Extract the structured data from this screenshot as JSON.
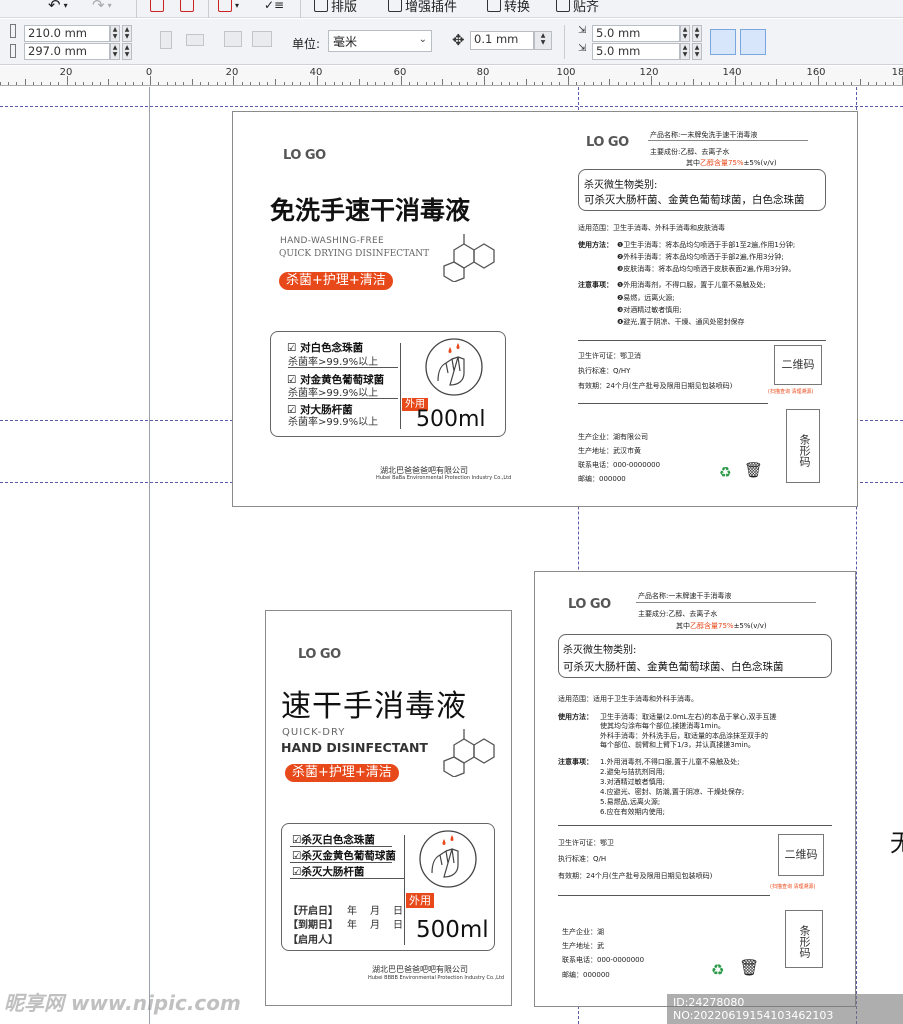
{
  "toolbar_top": {
    "items": [
      {
        "label": "排版"
      },
      {
        "label": "增强插件"
      },
      {
        "label": "转换"
      },
      {
        "label": "贴齐"
      }
    ]
  },
  "property_bar": {
    "width": "210.0 mm",
    "height": "297.0 mm",
    "unit_label": "单位:",
    "unit_value": "毫米",
    "nudge": "0.1 mm",
    "dup_x": "5.0 mm",
    "dup_y": "5.0 mm"
  },
  "ruler": {
    "labels": [
      "20",
      "0",
      "20",
      "40",
      "60",
      "80",
      "100",
      "120",
      "140",
      "160",
      "18"
    ]
  },
  "label1": {
    "logo": "LO GO",
    "title": "免洗手速干消毒液",
    "en1": "HAND-WASHING-FREE",
    "en2": "QUICK DRYING DISINFECTANT",
    "pill": "杀菌+护理+清洁",
    "claims": [
      {
        "title": "对白色念珠菌",
        "rate": "杀菌率>99.9%以上"
      },
      {
        "title": "对金黄色葡萄球菌",
        "rate": "杀菌率>99.9%以上"
      },
      {
        "title": "对大肠杆菌",
        "rate": "杀菌率>99.9%以上"
      }
    ],
    "tag": "外用",
    "volume": "500ml",
    "company": "湖北巴爸爸爸吧有限公司",
    "company_en": "Hubei BaBa Environmental Protection Industry Co.,Ltd"
  },
  "label1_back": {
    "logo": "LO GO",
    "name": "产品名称:一末牌免洗手速干消毒液",
    "ingredients": "主要成份:乙醇、去离子水",
    "content_prefix": "其中",
    "content_red": "乙醇含量75%",
    "content_suffix": "±5%(v/v)",
    "kill_head": "杀灭微生物类别:",
    "kill_list": "可杀灭大肠杆菌、金黄色葡萄球菌，白色念珠菌",
    "scope": "适用范围：卫生手消毒、外科手消毒和皮肤消毒",
    "usage_head": "使用方法：",
    "usage": [
      "❶卫生手消毒：将本品均匀喷洒于手部1至2遍,作用1分钟;",
      "❷外科手消毒：将本品均匀喷洒于手部2遍,作用3分钟;",
      "❸皮肤消毒：将本品均匀喷洒于皮肤表面2遍,作用3分钟。"
    ],
    "notes_head": "注意事项：",
    "notes": [
      "❶外用消毒剂，不得口服，置于儿童不易触及处;",
      "❷易燃，远离火源;",
      "❸对酒精过敏者慎用;",
      "❹避光,置于阴凉、干燥、通风处密封保存"
    ],
    "license": "卫生许可证：鄂卫消",
    "standard": "执行标准：Q/HY",
    "validity": "有效期：24个月(生产批号及限用日期见包装喷码)",
    "qr": "二维码",
    "qr_note": "(扫描查询 清理溯源)",
    "barcode": "条形码",
    "maker": "生产企业：湖有限公司",
    "address": "生产地址：武汉市黄",
    "phone": "联系电话：000-0000000",
    "post": "邮编：000000"
  },
  "label2": {
    "logo": "LO GO",
    "title": "速干手消毒液",
    "en1": "QUICK-DRY",
    "en2": "HAND DISINFECTANT",
    "pill": "杀菌+护理+清洁",
    "claims": [
      "杀灭白色念珠菌",
      "杀灭金黄色葡萄球菌",
      "杀灭大肠杆菌"
    ],
    "open_date": "【开启日】",
    "exp_date": "【到期日】",
    "user": "【启用人】",
    "ymd": [
      "年",
      "月",
      "日"
    ],
    "tag": "外用",
    "volume": "500ml",
    "company": "湖北巴巴爸爸吧吧有限公司",
    "company_en": "Hubei BBBB Environmental Protection Industry Co.,Ltd"
  },
  "label2_back": {
    "logo": "LO GO",
    "name": "产品名称:一末牌速干手消毒液",
    "ingredients": "主要成分:乙醇、去离子水",
    "content_prefix": "其中",
    "content_red": "乙醇含量75%",
    "content_suffix": "±5%(v/v)",
    "kill_head": "杀灭微生物类别:",
    "kill_list": "可杀灭大肠杆菌、金黄色葡萄球菌、白色念珠菌",
    "scope": "适用范围：适用于卫生手消毒和外科手消毒。",
    "usage_head": "使用方法：",
    "usage": [
      "卫生手消毒：取适量(2.0mL左右)的本品于掌心,双手互搓",
      "使其均匀涂布每个部位,揉搓消毒1min。",
      "外科手消毒：外科洗手后，取适量的本品涂抹至双手的",
      "每个部位、前臂和上臂下1/3，并认真揉搓3min。"
    ],
    "notes_head": "注意事项：",
    "notes": [
      "1.外用消毒剂,不得口服,置于儿童不易触及处;",
      "2.避免与拮抗剂同用;",
      "3.对酒精过敏者慎用;",
      "4.应避光、密封、防潮,置于阴凉、干燥处保存;",
      "5.易燃品,远离火源;",
      "6.应在有效期内使用;"
    ],
    "license": "卫生许可证：鄂卫",
    "standard": "执行标准：Q/H",
    "validity": "有效期：24个月(生产批号及限用日期见包装喷码)",
    "qr": "二维码",
    "qr_note": "(扫描查询 清理溯源)",
    "barcode": "条形码",
    "maker": "生产企业：湖",
    "address": "生产地址：武",
    "phone": "联系电话：000-0000000",
    "post": "邮编：000000"
  },
  "watermark": {
    "brand": "昵享网 www.nipic.com",
    "id": "ID:24278080 NO:20220619154103462103"
  },
  "edge_char": "无"
}
